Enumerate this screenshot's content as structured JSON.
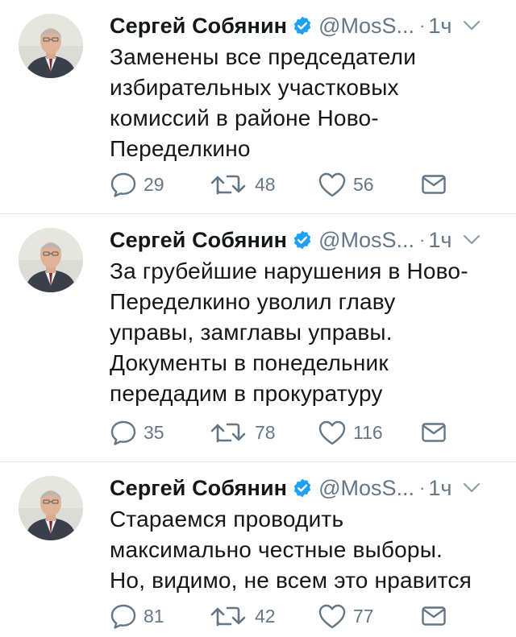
{
  "tweets": [
    {
      "author": "Сергей Собянин",
      "handle": "@MosS...",
      "dot": "·",
      "time": "1ч",
      "text": "Заменены все председатели\nизбирательных участковых\nкомиссий в районе Ново-\nПеределкино",
      "replies": "29",
      "retweets": "48",
      "likes": "56"
    },
    {
      "author": "Сергей Собянин",
      "handle": "@MosS...",
      "dot": "·",
      "time": "1ч",
      "text": "За грубейшие нарушения в Ново-\nПеределкино уволил главу\nуправы, замглавы управы.\nДокументы в понедельник\nпередадим в прокуратуру",
      "replies": "35",
      "retweets": "78",
      "likes": "116"
    },
    {
      "author": "Сергей Собянин",
      "handle": "@MosS...",
      "dot": "·",
      "time": "1ч",
      "text": "Стараемся проводить\nмаксимально честные выборы.\nНо, видимо, не всем это нравится",
      "replies": "81",
      "retweets": "42",
      "likes": "77"
    }
  ],
  "icons": {
    "verified": "verified-badge-icon",
    "caret": "chevron-down-icon",
    "reply": "reply-icon",
    "retweet": "retweet-icon",
    "like": "heart-icon",
    "dm": "envelope-icon"
  },
  "colors": {
    "text": "#14171a",
    "secondary": "#657786",
    "verified": "#1da1f2",
    "divider": "#e1e8ed"
  }
}
